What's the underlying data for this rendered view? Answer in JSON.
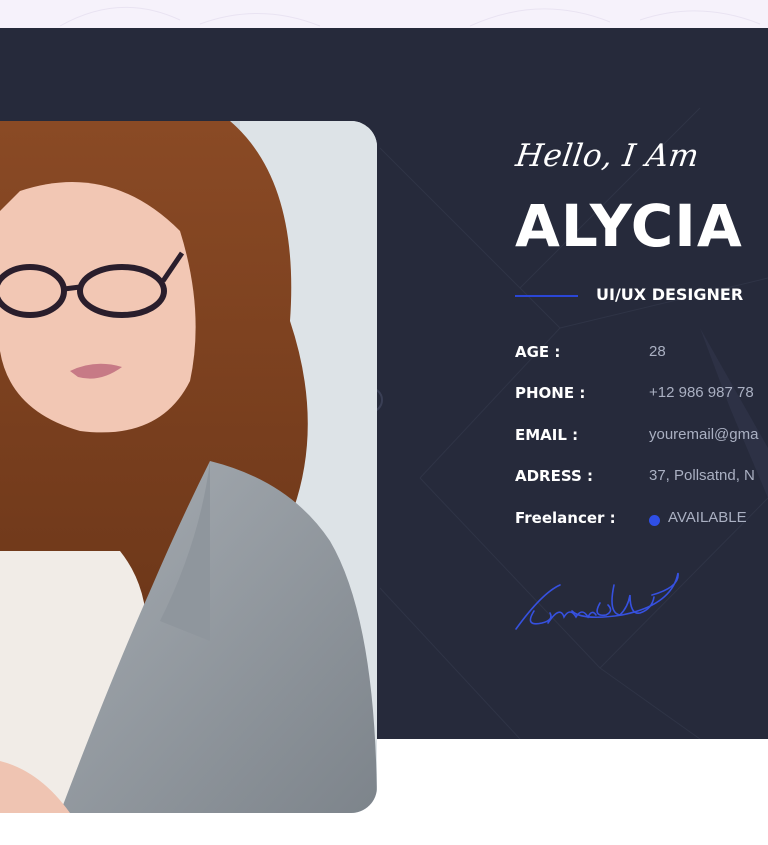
{
  "hero": {
    "greeting": "Hello, I Am",
    "name": "ALYCIA",
    "role": "UI/UX DESIGNER"
  },
  "info": [
    {
      "label": "AGE :",
      "value": "28"
    },
    {
      "label": "PHONE :",
      "value": "+12 986 987 78"
    },
    {
      "label": "EMAIL :",
      "value": "youremail@gma"
    },
    {
      "label": "ADRESS :",
      "value": "37, Pollsatnd, N"
    }
  ],
  "freelancer": {
    "label": "Freelancer :",
    "status": "AVAILABLE",
    "status_color": "#2f4fe6"
  },
  "colors": {
    "panel": "#262a3b",
    "accent": "#2a46d6",
    "top_strip": "#f6f2fb"
  },
  "images": {
    "portrait": "portrait-photo",
    "signature": "handwritten-signature"
  }
}
